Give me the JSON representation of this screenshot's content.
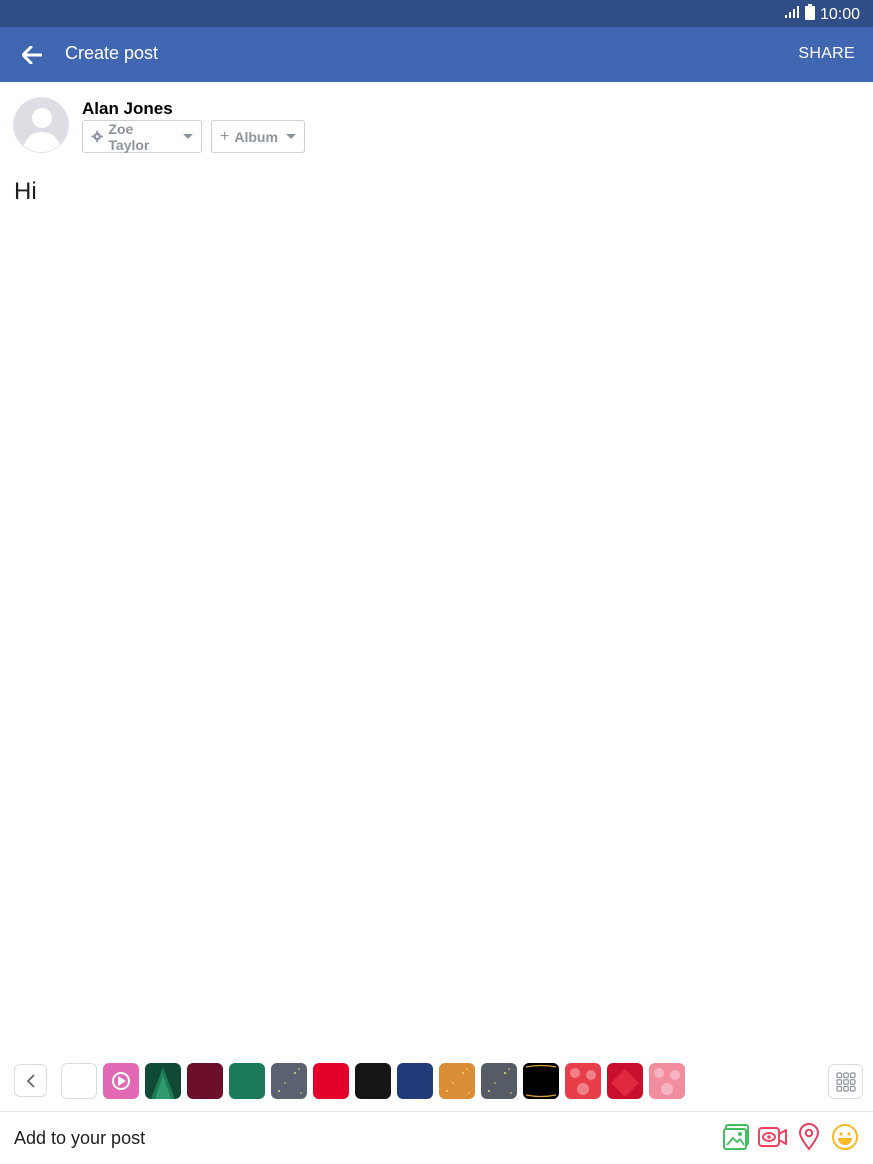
{
  "status_bar": {
    "time": "10:00",
    "signal_icon": "signal-icon",
    "battery_icon": "battery-icon"
  },
  "app_bar": {
    "title": "Create post",
    "share_label": "SHARE",
    "back_icon": "back-arrow-icon"
  },
  "composer": {
    "user_name": "Alan Jones",
    "privacy_label": "Zoe Taylor",
    "album_label": "Album",
    "post_text": "Hi"
  },
  "backgrounds": {
    "swatches": [
      {
        "name": "plain-white",
        "color": "#ffffff"
      },
      {
        "name": "pink-hearts-animated",
        "color": "#e26ab4"
      },
      {
        "name": "dark-green-tree",
        "color": "#0f4a35"
      },
      {
        "name": "maroon",
        "color": "#6b0f2a"
      },
      {
        "name": "emerald",
        "color": "#1a7a5a"
      },
      {
        "name": "slate-confetti",
        "color": "#5b6370"
      },
      {
        "name": "red",
        "color": "#e4002b"
      },
      {
        "name": "black",
        "color": "#151515"
      },
      {
        "name": "navy",
        "color": "#233a78"
      },
      {
        "name": "orange-glitter",
        "color": "#d98e35"
      },
      {
        "name": "grey-glitter",
        "color": "#555c66"
      },
      {
        "name": "black-gold",
        "color": "#000000"
      },
      {
        "name": "red-hearts",
        "color": "#e83e4a"
      },
      {
        "name": "red-diamond",
        "color": "#c8102e"
      },
      {
        "name": "pink-hearts",
        "color": "#f28da0"
      }
    ]
  },
  "add_to_post": {
    "label": "Add to your post"
  },
  "colors": {
    "status_bar": "#2f4e87",
    "app_bar": "#4267b2",
    "photo_green": "#45bd62",
    "video_red": "#f3425f",
    "checkin_pink": "#e4405f",
    "feeling_yellow": "#f7b928"
  }
}
